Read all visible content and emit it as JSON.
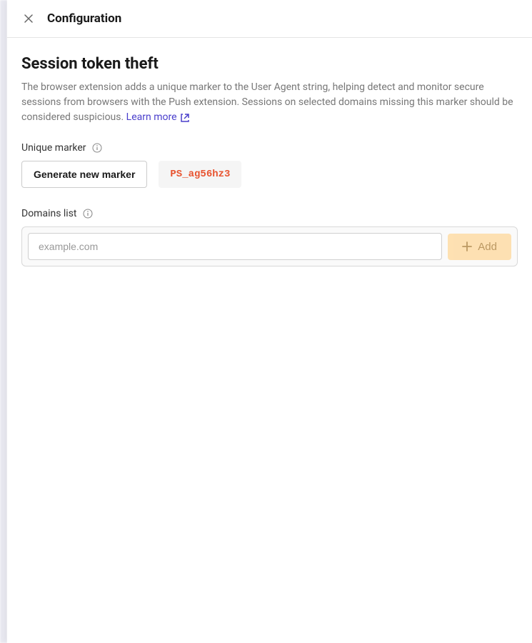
{
  "header": {
    "title": "Configuration"
  },
  "section": {
    "title": "Session token theft",
    "description": "The browser extension adds a unique marker to the User Agent string, helping detect and monitor secure sessions from browsers with the Push extension. Sessions on selected domains missing this marker should be considered suspicious.",
    "learn_more_label": "Learn more"
  },
  "marker": {
    "label": "Unique marker",
    "generate_button": "Generate new marker",
    "value": "PS_ag56hz3"
  },
  "domains": {
    "label": "Domains list",
    "placeholder": "example.com",
    "add_button": "Add"
  }
}
